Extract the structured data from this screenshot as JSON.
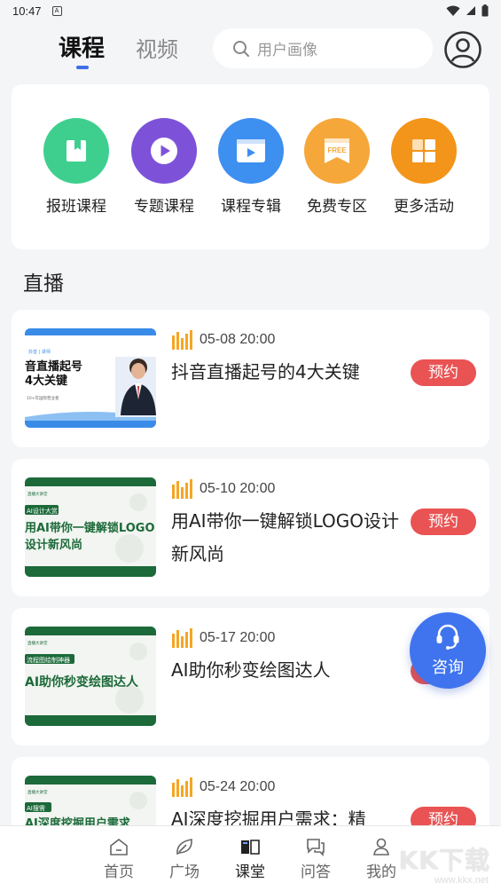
{
  "status_bar": {
    "time": "10:47",
    "app_glyph": "A"
  },
  "header": {
    "tabs": [
      {
        "label": "课程",
        "active": true
      },
      {
        "label": "视频",
        "active": false
      }
    ],
    "search": {
      "placeholder": "用户画像",
      "icon": "search-icon"
    },
    "avatar_icon": "user-avatar-icon"
  },
  "categories": [
    {
      "label": "报班课程",
      "color": "#3ecf8e",
      "icon": "bookmark-book-icon"
    },
    {
      "label": "专题课程",
      "color": "#7d52d9",
      "icon": "play-circle-icon"
    },
    {
      "label": "课程专辑",
      "color": "#3d8ff0",
      "icon": "video-player-icon"
    },
    {
      "label": "免费专区",
      "color": "#f6a73a",
      "icon": "free-banner-icon",
      "badge": "FREE"
    },
    {
      "label": "更多活动",
      "color": "#f2951a",
      "icon": "grid-tiles-icon"
    }
  ],
  "section": {
    "title": "直播"
  },
  "live_items": [
    {
      "time": "05-08 20:00",
      "title": "抖音直播起号的4大关键",
      "button": "预约",
      "thumb": {
        "style": "blue",
        "tag": "抖音 | 讲师",
        "line1": "音直播起号",
        "line2": "4大关键",
        "footer": "10+年国际营业者"
      }
    },
    {
      "time": "05-10 20:00",
      "title": "用AI带你一键解锁LOGO设计新风尚",
      "button": "预约",
      "thumb": {
        "style": "green",
        "tag": "直播大讲堂",
        "pill": "AI设计大赏",
        "line1": "用AI带你一键解锁LOGO",
        "line2": "设计新风尚"
      }
    },
    {
      "time": "05-17 20:00",
      "title": "AI助你秒变绘图达人",
      "button": "预约",
      "thumb": {
        "style": "green",
        "tag": "直播大讲堂",
        "pill": "流程图绘制神器",
        "line1": "AI助你秒变绘图达人",
        "line2": ""
      }
    },
    {
      "time": "05-24 20:00",
      "title": "AI深度挖掘用户需求：精",
      "button": "预约",
      "thumb": {
        "style": "green",
        "tag": "直播大讲堂",
        "pill": "AI搜需",
        "line1": "AI深度挖掘用户需求",
        "line2": ""
      }
    }
  ],
  "fab": {
    "label": "咨询",
    "icon": "headset-icon"
  },
  "bottom_nav": [
    {
      "label": "首页",
      "icon": "home-icon",
      "active": false
    },
    {
      "label": "广场",
      "icon": "leaf-icon",
      "active": false
    },
    {
      "label": "课堂",
      "icon": "open-book-icon",
      "active": true
    },
    {
      "label": "问答",
      "icon": "chat-bubbles-icon",
      "active": false
    },
    {
      "label": "我的",
      "icon": "person-icon",
      "active": false
    }
  ],
  "watermark": {
    "text": "KK下载",
    "url": "www.kkx.net"
  },
  "colors": {
    "accent": "#3d6fe6",
    "reserve_button": "#e95353",
    "live_bars": "#f5a623"
  }
}
